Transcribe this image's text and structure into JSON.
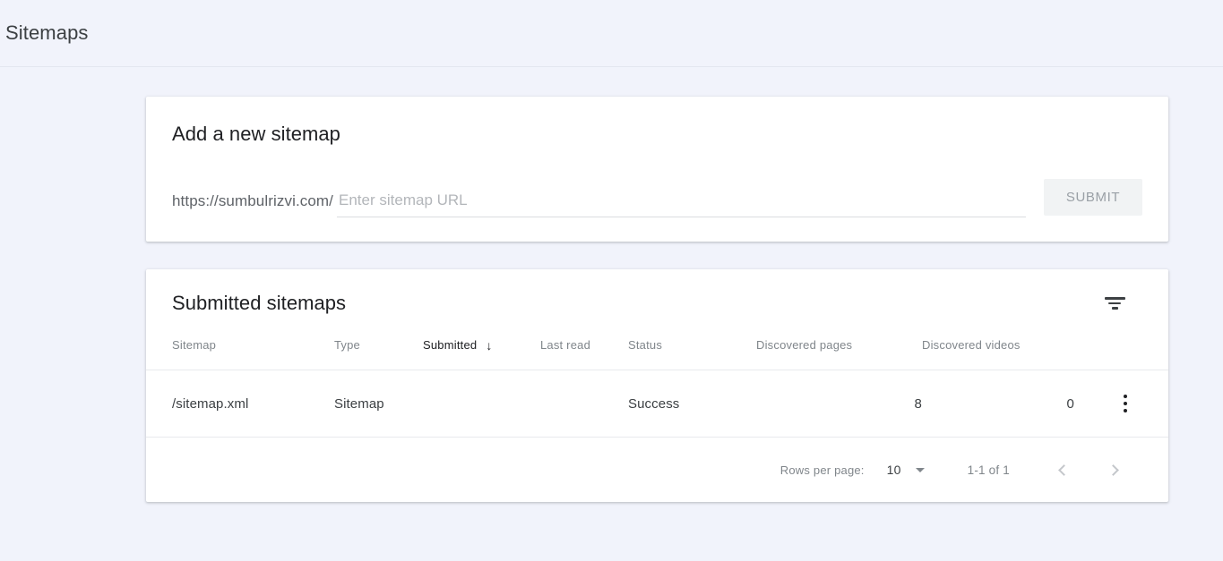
{
  "page": {
    "title": "Sitemaps"
  },
  "add_sitemap": {
    "heading": "Add a new sitemap",
    "url_prefix": "https://sumbulrizvi.com/",
    "input_placeholder": "Enter sitemap URL",
    "input_value": "",
    "submit_label": "SUBMIT"
  },
  "submitted": {
    "heading": "Submitted sitemaps",
    "filter_icon": "filter-icon",
    "columns": [
      {
        "label": "Sitemap",
        "sorted": false
      },
      {
        "label": "Type",
        "sorted": false
      },
      {
        "label": "Submitted",
        "sorted": true,
        "sort_arrow": "↓"
      },
      {
        "label": "Last read",
        "sorted": false
      },
      {
        "label": "Status",
        "sorted": false
      },
      {
        "label": "Discovered pages",
        "sorted": false
      },
      {
        "label": "Discovered videos",
        "sorted": false
      }
    ],
    "rows": [
      {
        "sitemap": "/sitemap.xml",
        "type": "Sitemap",
        "submitted": "",
        "last_read": "",
        "status": "Success",
        "status_color": "#188038",
        "discovered_pages": "8",
        "discovered_videos": "0",
        "menu_icon": "more-vertical-icon"
      }
    ],
    "pagination": {
      "rows_per_page_label": "Rows per page:",
      "rows_per_page_value": "10",
      "range_label": "1-1 of 1",
      "prev_icon": "chevron-left-icon",
      "next_icon": "chevron-right-icon"
    }
  }
}
